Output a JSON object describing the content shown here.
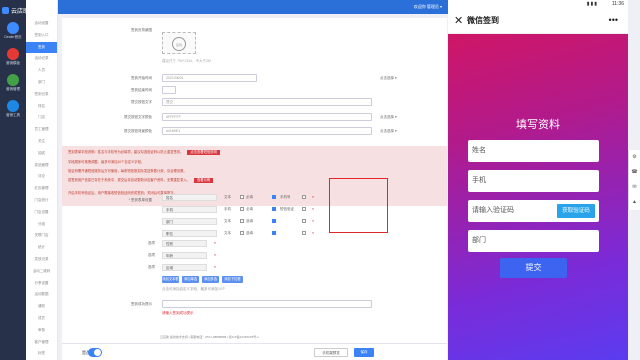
{
  "app": {
    "logo": "云店助"
  },
  "rail": [
    {
      "label": "Dealer首页",
      "color": "#3d8bff"
    },
    {
      "label": "营销模板",
      "color": "#e53935"
    },
    {
      "label": "营销管理",
      "color": "#43a047"
    },
    {
      "label": "营销工具",
      "color": "#1e88e5"
    }
  ],
  "side": {
    "items": [
      "活动设置",
      "签到入口",
      "签到",
      "活动记录",
      "人员",
      "部门",
      "签到记录",
      "排名",
      "门店",
      "员工管理",
      "关注",
      "抽奖",
      "奖品管理",
      "评论",
      "红包管理",
      "门店统计",
      "门店设置",
      "分组",
      "关联门店",
      "统计",
      "发放记录",
      "活动二维码",
      "分享设置",
      "活动数据",
      "通知",
      "成员",
      "审核",
      "客户管理",
      "标签",
      "系统设置"
    ],
    "active_index": 2
  },
  "topbar": {
    "user": "欢迎你 管理员 ▾"
  },
  "form": {
    "rows": [
      {
        "label": "签到页背景图",
        "value": "",
        "hint": ""
      },
      {
        "label": "签到开始时间",
        "value": "2021/06/01",
        "hint": "点击选择 ▾"
      },
      {
        "label": "签到结束时间",
        "value": "2021/06/30",
        "hint": ""
      },
      {
        "label": "提交按钮文字",
        "value": "提交",
        "hint": ""
      },
      {
        "label": "提交按钮文字颜色",
        "value": "#FFFFFF",
        "hint": "点击选择 ▾"
      },
      {
        "label": "提交按钮背景颜色",
        "value": "#4169E1",
        "hint": "点击选择 ▾"
      }
    ],
    "upload_caption": "建议尺寸 750*1334，不大于2M",
    "stamp": "签到",
    "alert_lines": [
      "签到表单字段说明：姓名与手机号为必填项，建议勾选验证码以防止重复签到。",
      "字段顺序可拖拽调整，最多可添加10个自定义字段。",
      "验证码需开通短信服务后方可使用，每条短信按实际发送条数计费，请合理设置。",
      "若签到用户信息已存在于系统中，提交后将自动更新对应客户资料，无需重复录入。",
      "开启手机号验证后，用户需接收短信验证码完成签到；关闭后可直接提交。"
    ],
    "alert_buttons": [
      "点击查看短信说明",
      "查看示例"
    ],
    "fields_label": "* 签到表单设置",
    "fields": [
      {
        "name": "姓名",
        "type": "文本",
        "req": "必填",
        "mobile": "手机号"
      },
      {
        "name": "手机",
        "type": "手机",
        "req": "必填",
        "mobile": "短信验证"
      },
      {
        "name": "部门",
        "type": "文本",
        "req": "选填",
        "mobile": ""
      },
      {
        "name": "职位",
        "type": "文本",
        "req": "选填",
        "mobile": ""
      }
    ],
    "extra_fields": [
      {
        "label": "选项",
        "value": "性别"
      },
      {
        "label": "选项",
        "value": "年龄"
      },
      {
        "label": "选项",
        "value": "区域"
      }
    ],
    "add_buttons": [
      "添加文本框",
      "添加单选",
      "添加多选",
      "添加下拉框"
    ],
    "add_hint": "点击可添加自定义字段，最多可添加10个",
    "rule_label": "签到成功提示",
    "rule_value": "",
    "rule_error": "请输入签到成功提示",
    "footnote": "云店助 提供技术支持 | 客服电话：0571-88888888 | 浙ICP备12345678号-1"
  },
  "footer": {
    "label": "是否开启",
    "cancel": "手机端预览",
    "save": "保存"
  },
  "phone": {
    "time": "11:36",
    "signal": "▮▮▮",
    "nav_title": "微信签到",
    "close": "✕",
    "more": "•••",
    "heading": "填写资料",
    "inputs": [
      {
        "placeholder": "姓名"
      },
      {
        "placeholder": "手机"
      },
      {
        "placeholder": "请输入验证码"
      },
      {
        "placeholder": "部门"
      }
    ],
    "code_button": "获取验证码",
    "submit": "提交"
  },
  "rtools": [
    "⚙",
    "☎",
    "✉",
    "▲"
  ],
  "colors": {
    "accent": "#3b82f6",
    "alert_bg": "#f6e0e2",
    "danger": "#d9363e",
    "submit": "#3c64f0"
  }
}
